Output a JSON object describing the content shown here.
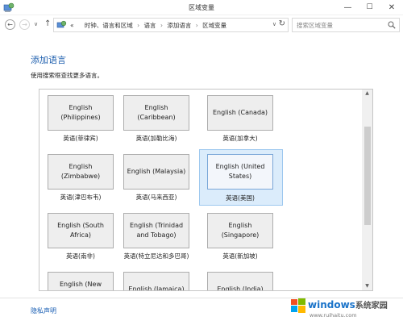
{
  "window": {
    "title": "区域变量",
    "minimize": "—",
    "maximize": "☐",
    "close": "✕"
  },
  "nav": {
    "back": "←",
    "forward": "→",
    "recent": "∨",
    "up": "↑"
  },
  "address": {
    "prefix": "«",
    "breadcrumbs": [
      "时钟、语言和区域",
      "语言",
      "添加语言",
      "区域变量"
    ],
    "dropdown": "∨",
    "refresh": "↻"
  },
  "search": {
    "placeholder": "搜索区域变量"
  },
  "page": {
    "heading": "添加语言",
    "description": "使用搜索框查找更多语言。"
  },
  "tiles": [
    {
      "name": "English (Philippines)",
      "label": "英语(菲律宾)"
    },
    {
      "name": "English (Caribbean)",
      "label": "英语(加勒比海)"
    },
    {
      "name": "English (Canada)",
      "label": "英语(加拿大)"
    },
    {
      "name": "English (Zimbabwe)",
      "label": "英语(津巴布韦)"
    },
    {
      "name": "English (Malaysia)",
      "label": "英语(马来西亚)"
    },
    {
      "name": "English (United States)",
      "label": "英语(美国)",
      "selected": true
    },
    {
      "name": "English (South Africa)",
      "label": "英语(南非)"
    },
    {
      "name": "English (Trinidad and Tobago)",
      "label": "英语(特立尼达和多巴哥)"
    },
    {
      "name": "English (Singapore)",
      "label": "英语(新加坡)"
    },
    {
      "name": "English (New Zealand)",
      "label": ""
    },
    {
      "name": "English (Jamaica)",
      "label": ""
    },
    {
      "name": "English (India)",
      "label": ""
    }
  ],
  "scrollbar": {
    "up": "▲",
    "down": "▼"
  },
  "footer": {
    "privacy": "隐私声明"
  },
  "watermark": {
    "brand": "windows",
    "brand_suffix": "系统家园",
    "url": "www.ruihaitu.com"
  },
  "colors": {
    "heading": "#1e5fae",
    "link": "#1a5fb4",
    "selected_bg": "#dbecfb",
    "tile_bg": "#eeeeee"
  }
}
